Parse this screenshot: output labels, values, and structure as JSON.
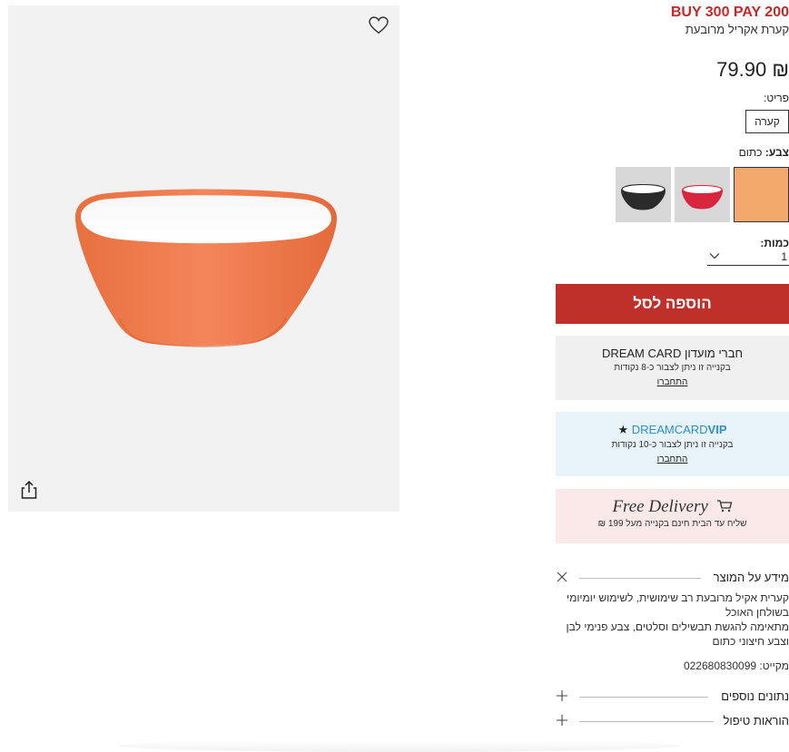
{
  "product": {
    "promo": "BUY 300 PAY 200",
    "name": "קערת אקריל מרובעת",
    "price": "₪ 79.90",
    "item_label": "פריט:",
    "item_value": "קערה",
    "color_label": "צבע:",
    "color_value": "כתום",
    "qty_label": "כמות:",
    "qty_value": "1",
    "add_to_cart": "הוספה לסל"
  },
  "colors": {
    "accent": "#c0302b",
    "promo": "#c62828",
    "selected_swatch": "#f4a96c",
    "vip_blue": "#2b8fd0"
  },
  "dream_card": {
    "title": "חברי מועדון DREAM CARD",
    "subtitle": "בקנייה זו ניתן לצבור כ-8 נקודות",
    "link": "התחברו"
  },
  "vip_card": {
    "star": "★",
    "brand_light": "DREAMCARD",
    "brand_bold": "VIP",
    "subtitle": "בקנייה זו ניתן לצבור כ-10 נקודות",
    "link": "התחברו"
  },
  "delivery": {
    "title": "Free Delivery",
    "subtitle": "שליח עד הבית חינם בקנייה מעל 199 ₪"
  },
  "info": {
    "title": "מידע על המוצר",
    "line1": "קערית אקיל מרובעת רב שימושית, לשימוש יומיומי בשולחן האוכל",
    "line2": "מתאימה להגשת תבשילים וסלטים, צבע פנימי לבן וצבע חיצוני כתום",
    "sku": "מקייט: 022680830099"
  },
  "sections": {
    "more_data": "נתונים נוספים",
    "care": "הוראות טיפול"
  },
  "icons": {
    "wishlist": "heart-icon",
    "share": "share-icon",
    "close": "close-icon",
    "expand": "plus-icon",
    "cart": "cart-icon",
    "dropdown": "chevron-down-icon"
  }
}
